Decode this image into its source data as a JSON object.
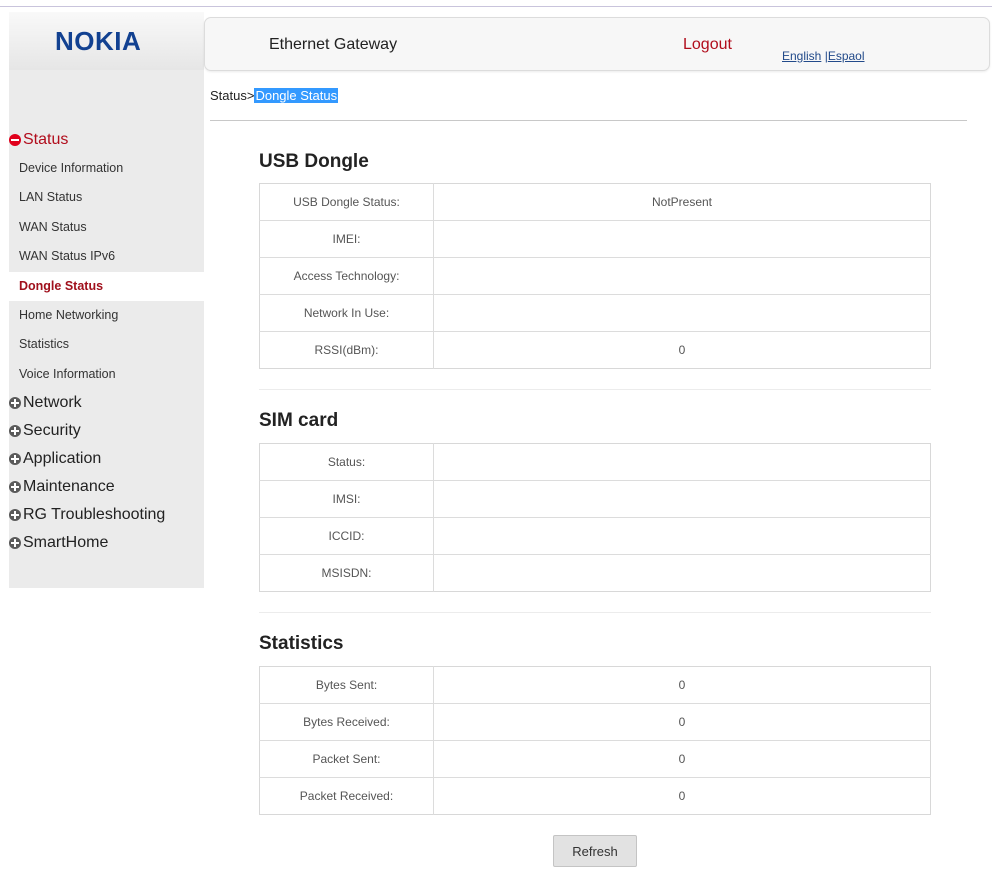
{
  "brand": {
    "logo": "NOKIA"
  },
  "header": {
    "title": "Ethernet Gateway",
    "logout": "Logout",
    "lang_english": "English",
    "lang_sep": " |",
    "lang_spanish": "Espaol"
  },
  "breadcrumb": {
    "parent": "Status>",
    "current": "Dongle Status"
  },
  "sidebar": {
    "status": {
      "label": "Status",
      "items": [
        "Device Information",
        "LAN Status",
        "WAN Status",
        "WAN Status IPv6",
        "Dongle Status",
        "Home Networking",
        "Statistics",
        "Voice Information"
      ],
      "active_index": 4
    },
    "sections": [
      "Network",
      "Security",
      "Application",
      "Maintenance",
      "RG Troubleshooting",
      "SmartHome"
    ]
  },
  "usb_dongle": {
    "title": "USB Dongle",
    "rows": [
      {
        "label": "USB Dongle Status:",
        "value": "NotPresent"
      },
      {
        "label": "IMEI:",
        "value": ""
      },
      {
        "label": "Access Technology:",
        "value": ""
      },
      {
        "label": "Network In Use:",
        "value": ""
      },
      {
        "label": "RSSI(dBm):",
        "value": "0"
      }
    ]
  },
  "sim_card": {
    "title": "SIM card",
    "rows": [
      {
        "label": "Status:",
        "value": ""
      },
      {
        "label": "IMSI:",
        "value": ""
      },
      {
        "label": "ICCID:",
        "value": ""
      },
      {
        "label": "MSISDN:",
        "value": ""
      }
    ]
  },
  "statistics": {
    "title": "Statistics",
    "rows": [
      {
        "label": "Bytes Sent:",
        "value": "0"
      },
      {
        "label": "Bytes Received:",
        "value": "0"
      },
      {
        "label": "Packet Sent:",
        "value": "0"
      },
      {
        "label": "Packet Received:",
        "value": "0"
      }
    ]
  },
  "actions": {
    "refresh": "Refresh"
  },
  "colors": {
    "brand_blue": "#124191",
    "accent_red": "#b10d1c",
    "highlight": "#3399ff"
  }
}
